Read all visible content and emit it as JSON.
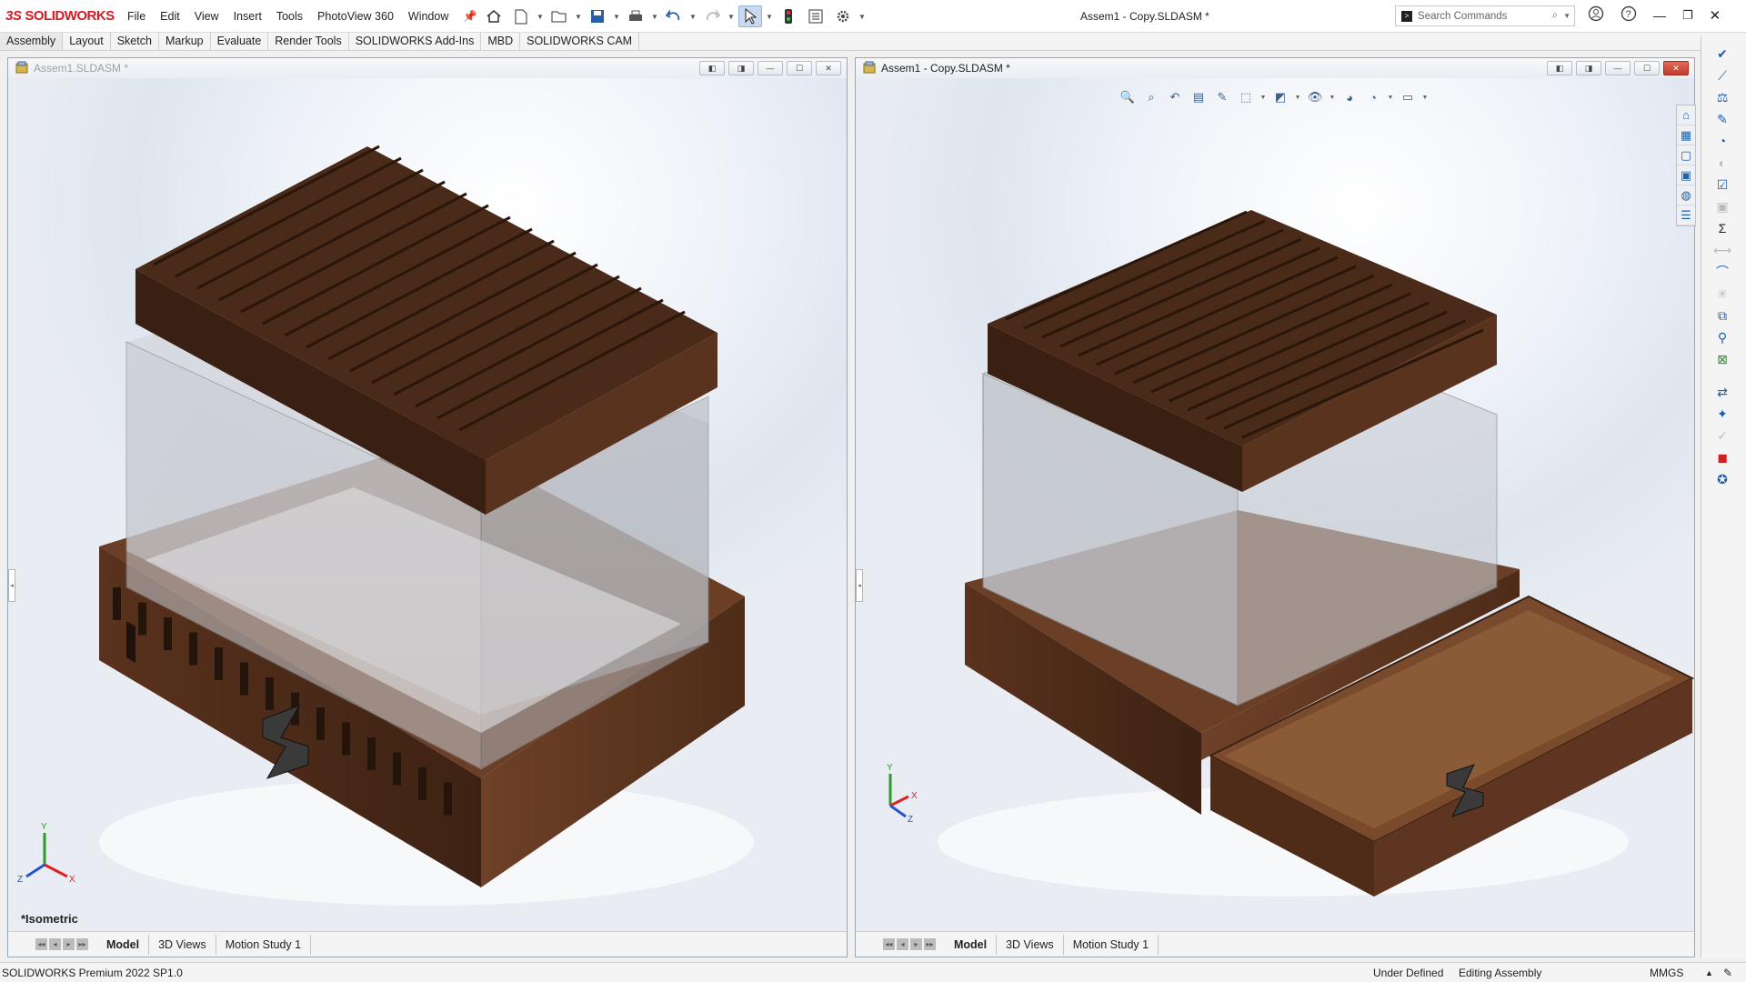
{
  "app": {
    "name": "SOLIDWORKS",
    "document_title": "Assem1 - Copy.SLDASM *"
  },
  "menu": [
    "File",
    "Edit",
    "View",
    "Insert",
    "Tools",
    "PhotoView 360",
    "Window"
  ],
  "search": {
    "placeholder": "Search Commands"
  },
  "command_tabs": [
    "Assembly",
    "Layout",
    "Sketch",
    "Markup",
    "Evaluate",
    "Render Tools",
    "SOLIDWORKS Add-Ins",
    "MBD",
    "SOLIDWORKS CAM"
  ],
  "viewports": [
    {
      "title": "Assem1.SLDASM *",
      "active": false,
      "view_label": "*Isometric",
      "bottom_tabs": [
        "Model",
        "3D Views",
        "Motion Study 1"
      ],
      "active_tab": "Model"
    },
    {
      "title": "Assem1 - Copy.SLDASM *",
      "active": true,
      "view_label": "",
      "bottom_tabs": [
        "Model",
        "3D Views",
        "Motion Study 1"
      ],
      "active_tab": "Model"
    }
  ],
  "axis_labels": {
    "x": "X",
    "y": "Y",
    "z": "Z"
  },
  "status": {
    "product": "SOLIDWORKS Premium 2022 SP1.0",
    "definition": "Under Defined",
    "mode": "Editing Assembly",
    "units": "MMGS"
  },
  "colors": {
    "brand_red": "#d71920",
    "wood_dark": "#4a2a18",
    "wood_mid": "#6b3f25",
    "glass": "#c9ccd2"
  }
}
